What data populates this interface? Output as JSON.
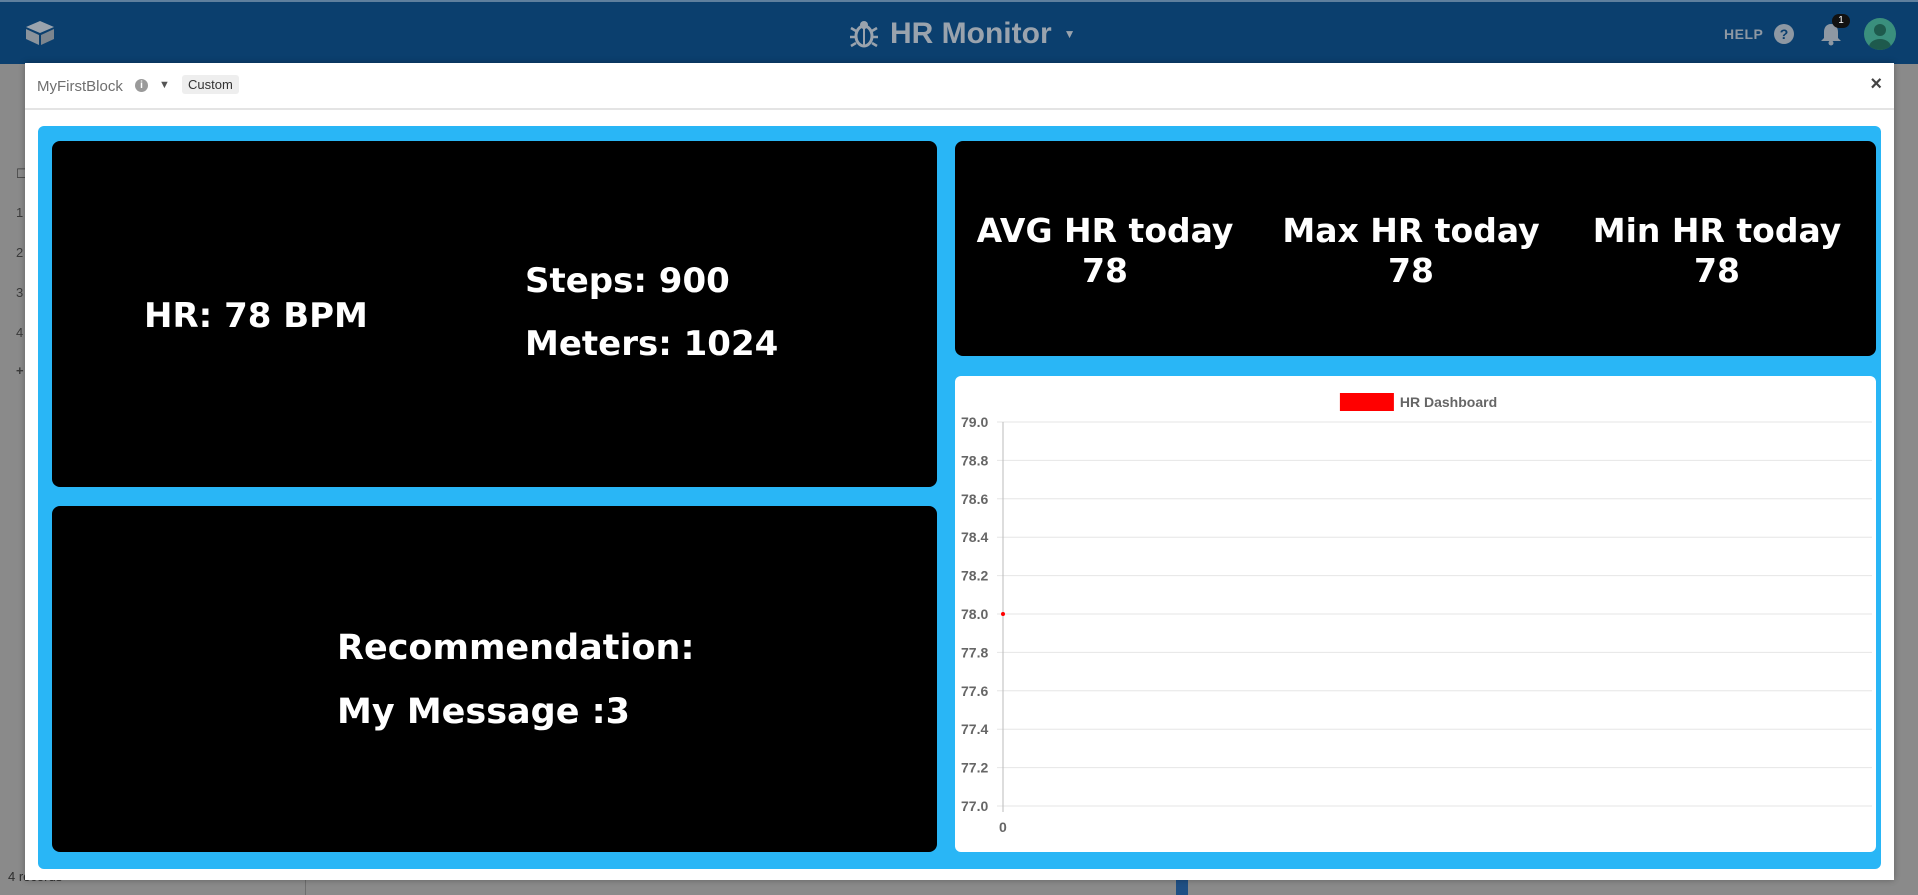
{
  "app": {
    "title": "HR Monitor",
    "help_label": "HELP",
    "notification_count": "1",
    "colors": {
      "topbar": "#0b3f6e",
      "accent": "#29b6f6",
      "series": "#ff0000"
    }
  },
  "background": {
    "row_numbers": [
      "1",
      "2",
      "3",
      "4",
      "+"
    ],
    "records_label": "4 records"
  },
  "modal": {
    "block_name": "MyFirstBlock",
    "chip_label": "Custom",
    "close_label": "×"
  },
  "dashboard": {
    "hr_label": "HR: 78 BPM",
    "steps_label": "Steps: 900",
    "meters_label": "Meters: 1024",
    "recommendation_title": "Recommendation:",
    "recommendation_message": "My Message :3",
    "stats": {
      "avg_label": "AVG HR today",
      "avg_value": "78",
      "max_label": "Max HR today",
      "max_value": "78",
      "min_label": "Min HR today",
      "min_value": "78"
    }
  },
  "chart_data": {
    "type": "line",
    "legend": "HR Dashboard",
    "legend_position": "top",
    "x": [
      "0"
    ],
    "series": [
      {
        "name": "HR Dashboard",
        "values": [
          78
        ],
        "color": "#ff0000"
      }
    ],
    "ylim": [
      77.0,
      79.0
    ],
    "yticks": [
      "79.0",
      "78.8",
      "78.6",
      "78.4",
      "78.2",
      "78.0",
      "77.8",
      "77.6",
      "77.4",
      "77.2",
      "77.0"
    ],
    "xticks": [
      "0"
    ],
    "grid": true
  }
}
